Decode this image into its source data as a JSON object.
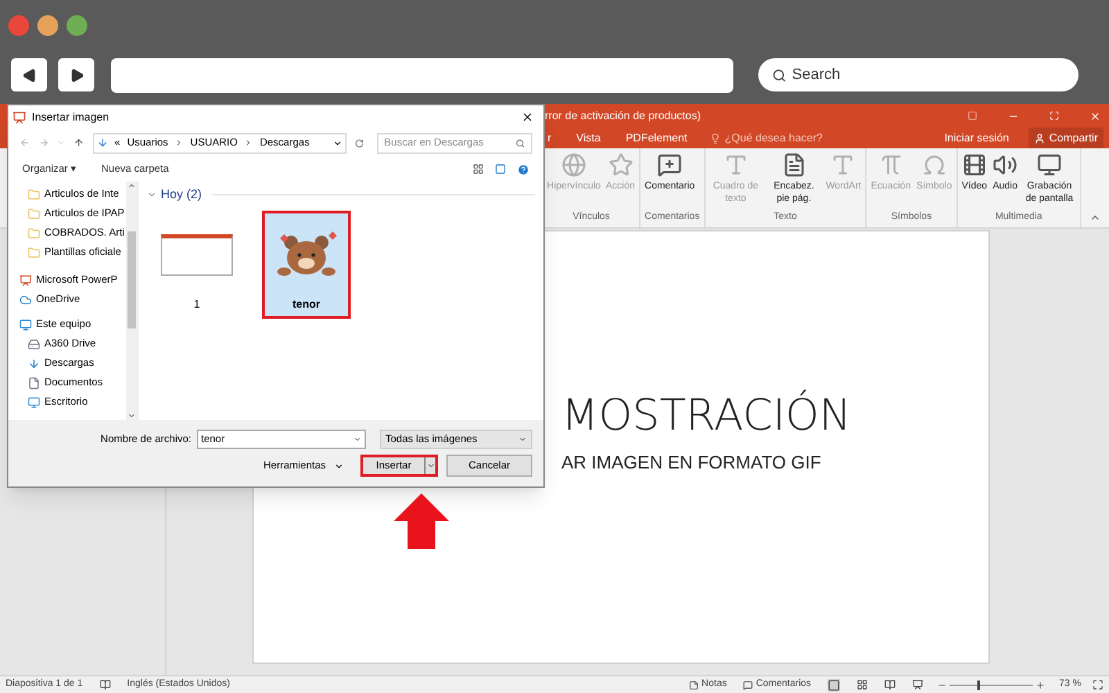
{
  "browser": {
    "search": {
      "placeholder": "Search"
    }
  },
  "app": {
    "title": "rror de activación de productos)",
    "tabs": [
      {
        "label": "r",
        "selected": false
      },
      {
        "label": "Vista",
        "selected": false
      },
      {
        "label": "PDFelement",
        "selected": false
      }
    ],
    "tell_me": "¿Qué desea hacer?",
    "sign_in": "Iniciar sesión",
    "share": "Compartir",
    "ribbon": [
      {
        "label": "Vínculos",
        "commands": [
          {
            "label": "Hipervínculo",
            "disabled": true
          },
          {
            "label": "Acción",
            "disabled": true
          }
        ]
      },
      {
        "label": "Comentarios",
        "commands": [
          {
            "label": "Comentario",
            "disabled": false
          }
        ]
      },
      {
        "label": "Texto",
        "commands": [
          {
            "label": "Cuadro de texto",
            "disabled": true
          },
          {
            "label": "Encabez. pie pág.",
            "disabled": false
          },
          {
            "label": "WordArt",
            "disabled": true
          }
        ]
      },
      {
        "label": "Símbolos",
        "commands": [
          {
            "label": "Ecuación",
            "disabled": true
          },
          {
            "label": "Símbolo",
            "disabled": true
          }
        ]
      },
      {
        "label": "Multimedia",
        "commands": [
          {
            "label": "Vídeo",
            "disabled": false
          },
          {
            "label": "Audio",
            "disabled": false
          },
          {
            "label": "Grabación de pantalla",
            "disabled": false
          }
        ]
      }
    ],
    "slide": {
      "title": "MOSTRACIÓN",
      "subtitle": "AR IMAGEN EN FORMATO GIF"
    },
    "status_bar": {
      "slide": "Diapositiva 1 de 1",
      "language": "Inglés (Estados Unidos)",
      "notes": "Notas",
      "comments": "Comentarios",
      "zoom": {
        "level": 0.33
      },
      "zoom_reading": "73 %"
    }
  },
  "dialog": {
    "title": "Insertar imagen",
    "path": [
      "«",
      "Usuarios",
      "USUARIO",
      "Descargas"
    ],
    "search": {
      "placeholder": "Buscar en Descargas"
    },
    "toolbar": [
      "Organizar ▾",
      "Nueva carpeta"
    ],
    "nav_pane": [
      {
        "label": "Articulos de Inte",
        "kind": "folder"
      },
      {
        "label": "Articulos de IPAP",
        "kind": "folder"
      },
      {
        "label": "COBRADOS. Arti",
        "kind": "folder"
      },
      {
        "label": "Plantillas oficiale",
        "kind": "folder"
      },
      {
        "label": "Microsoft PowerP",
        "kind": "app"
      },
      {
        "label": "OneDrive",
        "kind": "cloud"
      },
      {
        "label": "Este equipo",
        "kind": "computer",
        "children": [
          {
            "label": "A360 Drive",
            "kind": "drive"
          },
          {
            "label": "Descargas",
            "kind": "download"
          },
          {
            "label": "Documentos",
            "kind": "document"
          },
          {
            "label": "Escritorio",
            "kind": "desktop"
          }
        ]
      }
    ],
    "group": "Hoy (2)",
    "files": [
      {
        "name": "1",
        "kind": "slide",
        "selected": false,
        "highlighted": false
      },
      {
        "name": "tenor",
        "kind": "bear",
        "selected": true,
        "highlighted": true
      }
    ],
    "file_name_label": "Nombre de archivo:",
    "file_name": "tenor",
    "filter": "Todas las imágenes",
    "tools": "Herramientas",
    "buttons": [
      {
        "label": "Insertar",
        "kind": "split",
        "highlighted": true
      },
      {
        "label": "Cancelar",
        "kind": "plain",
        "highlighted": false
      }
    ]
  }
}
